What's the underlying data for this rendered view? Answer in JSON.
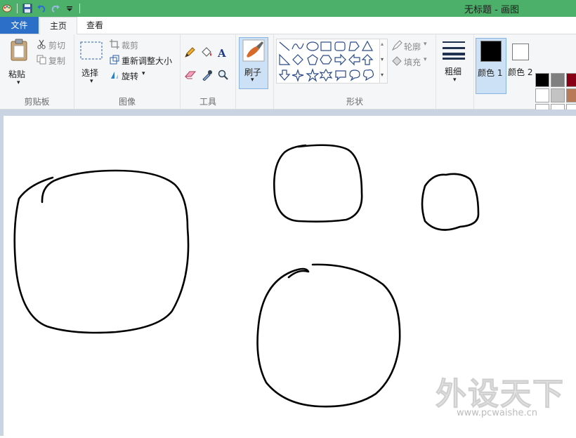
{
  "window": {
    "title": "无标题 - 画图"
  },
  "tabs": {
    "file": "文件",
    "home": "主页",
    "view": "查看"
  },
  "clipboard": {
    "paste": "粘贴",
    "cut": "剪切",
    "copy": "复制",
    "group": "剪贴板"
  },
  "image": {
    "select": "选择",
    "crop": "裁剪",
    "resize": "重新调整大小",
    "rotate": "旋转",
    "group": "图像"
  },
  "tools": {
    "group": "工具"
  },
  "brushes": {
    "label": "刷子"
  },
  "shapes": {
    "outline": "轮廓",
    "fill": "填充",
    "group": "形状"
  },
  "size": {
    "label": "粗细"
  },
  "colors": {
    "color1": "颜色 1",
    "color2": "颜色 2",
    "color1_value": "#000000",
    "color2_value": "#ffffff",
    "palette": [
      "#000000",
      "#7f7f7f",
      "#880015",
      "#ffffff",
      "#c3c3c3",
      "#b97a57"
    ]
  },
  "watermark": {
    "brand": "外设天下",
    "url": "www.pcwaishe.cn"
  }
}
